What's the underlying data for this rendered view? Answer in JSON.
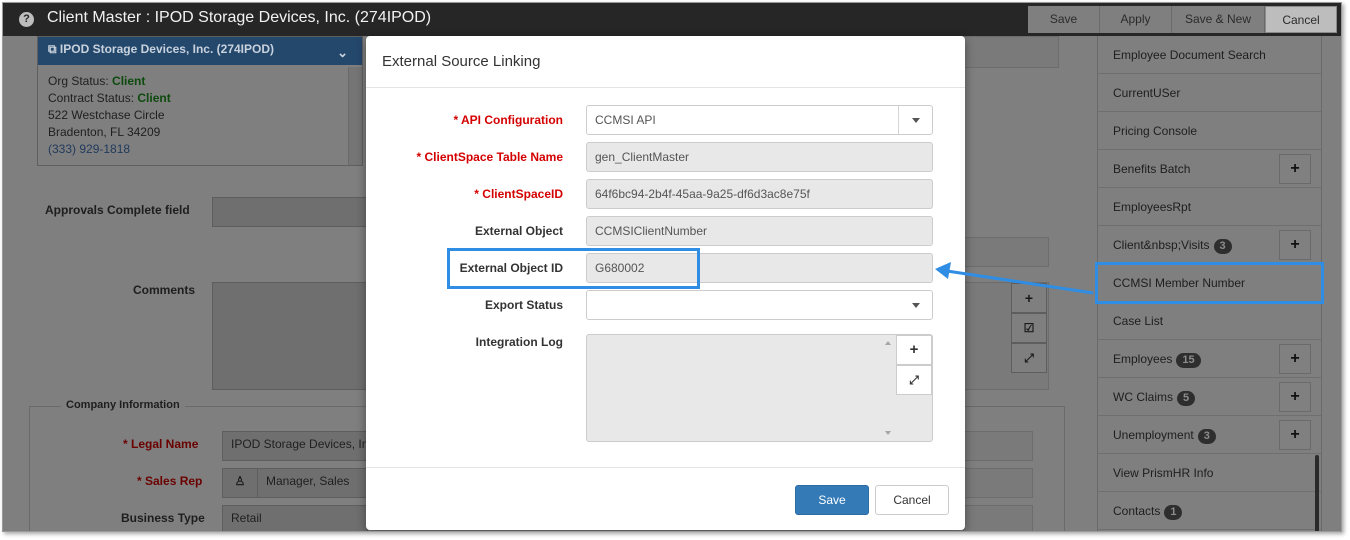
{
  "titlebar": {
    "help_icon": "?",
    "title": "Client Master : IPOD Storage Devices, Inc. (274IPOD)",
    "buttons": {
      "save": "Save",
      "apply": "Apply",
      "save_new": "Save & New",
      "cancel": "Cancel"
    }
  },
  "client_card": {
    "name": "IPOD Storage Devices, Inc. (274IPOD)",
    "org_status_label": "Org Status:",
    "org_status_value": "Client",
    "contract_status_label": "Contract Status:",
    "contract_status_value": "Client",
    "address1": "522 Westchase Circle",
    "address2": "Bradenton, FL 34209",
    "phone": "(333) 929-1818"
  },
  "background_form": {
    "approvals_label": "Approvals Complete field",
    "comments_label": "Comments",
    "company_info_title": "Company Information",
    "legal_name_label": "* Legal Name",
    "legal_name_value": "IPOD Storage Devices, Inc",
    "sales_rep_label": "* Sales Rep",
    "sales_rep_value": "Manager, Sales",
    "business_type_label": "Business Type",
    "business_type_value": "Retail"
  },
  "sidebar": {
    "items": [
      {
        "label": "Employee Document Search",
        "badge": "",
        "plus": false
      },
      {
        "label": "CurrentUSer",
        "badge": "",
        "plus": false
      },
      {
        "label": "Pricing Console",
        "badge": "",
        "plus": false
      },
      {
        "label": "Benefits Batch",
        "badge": "",
        "plus": true
      },
      {
        "label": "EmployeesRpt",
        "badge": "",
        "plus": false
      },
      {
        "label": "Client&nbsp;Visits",
        "badge": "3",
        "plus": true
      },
      {
        "label": "CCMSI Member Number",
        "badge": "",
        "plus": false
      },
      {
        "label": "Case List",
        "badge": "",
        "plus": false
      },
      {
        "label": "Employees",
        "badge": "15",
        "plus": true
      },
      {
        "label": "WC Claims",
        "badge": "5",
        "plus": true
      },
      {
        "label": "Unemployment",
        "badge": "3",
        "plus": true
      },
      {
        "label": "View PrismHR Info",
        "badge": "",
        "plus": false
      },
      {
        "label": "Contacts",
        "badge": "1",
        "plus": false
      }
    ]
  },
  "modal": {
    "title": "External Source Linking",
    "fields": {
      "api_config_label": "* API Configuration",
      "api_config_value": "CCMSI API",
      "table_name_label": "* ClientSpace Table Name",
      "table_name_value": "gen_ClientMaster",
      "clientspace_id_label": "* ClientSpaceID",
      "clientspace_id_value": "64f6bc94-2b4f-45aa-9a25-df6d3ac8e75f",
      "external_object_label": "External Object",
      "external_object_value": "CCMSIClientNumber",
      "external_object_id_label": "External Object ID",
      "external_object_id_value": "G680002",
      "export_status_label": "Export Status",
      "export_status_value": "",
      "integration_log_label": "Integration Log",
      "integration_log_value": ""
    },
    "save_label": "Save",
    "cancel_label": "Cancel"
  },
  "colors": {
    "highlight": "#2f8de4",
    "primary": "#337ab7",
    "required": "#d40000",
    "titlebar": "#262626"
  }
}
